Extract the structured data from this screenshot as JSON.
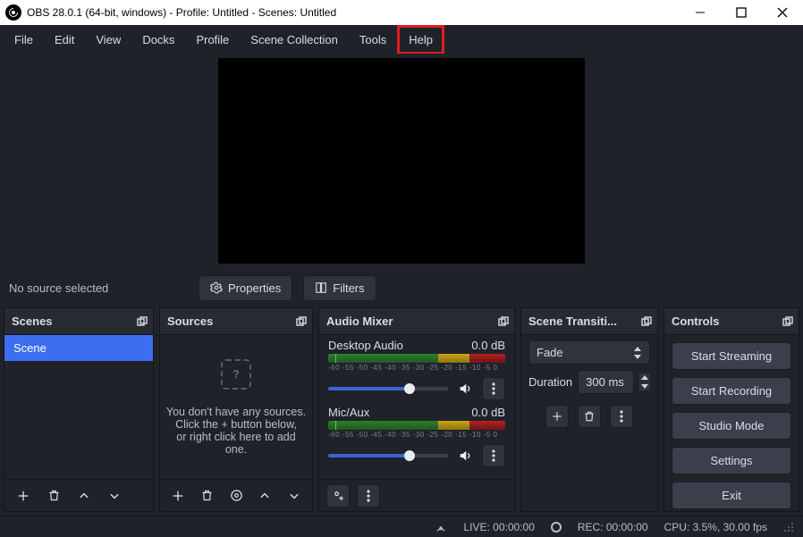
{
  "title": "OBS 28.0.1 (64-bit, windows) - Profile: Untitled - Scenes: Untitled",
  "menu": {
    "file": "File",
    "edit": "Edit",
    "view": "View",
    "docks": "Docks",
    "profile": "Profile",
    "scenecol": "Scene Collection",
    "tools": "Tools",
    "help": "Help"
  },
  "srcbar": {
    "nosrc": "No source selected",
    "properties": "Properties",
    "filters": "Filters"
  },
  "scenes": {
    "title": "Scenes",
    "items": [
      "Scene"
    ]
  },
  "sources": {
    "title": "Sources",
    "empty1": "You don't have any sources.",
    "empty2": "Click the + button below,",
    "empty3": "or right click here to add one."
  },
  "mixer": {
    "title": "Audio Mixer",
    "ticks": "-60 -55 -50 -45 -40 -35 -30 -25 -20 -15 -10 -5  0",
    "ch": [
      {
        "name": "Desktop Audio",
        "db": "0.0 dB"
      },
      {
        "name": "Mic/Aux",
        "db": "0.0 dB"
      }
    ]
  },
  "trans": {
    "title": "Scene Transiti...",
    "sel": "Fade",
    "dur_lbl": "Duration",
    "dur_val": "300 ms"
  },
  "controls": {
    "title": "Controls",
    "btns": [
      "Start Streaming",
      "Start Recording",
      "Studio Mode",
      "Settings",
      "Exit"
    ]
  },
  "status": {
    "live": "LIVE: 00:00:00",
    "rec": "REC: 00:00:00",
    "cpu": "CPU: 3.5%, 30.00 fps"
  }
}
